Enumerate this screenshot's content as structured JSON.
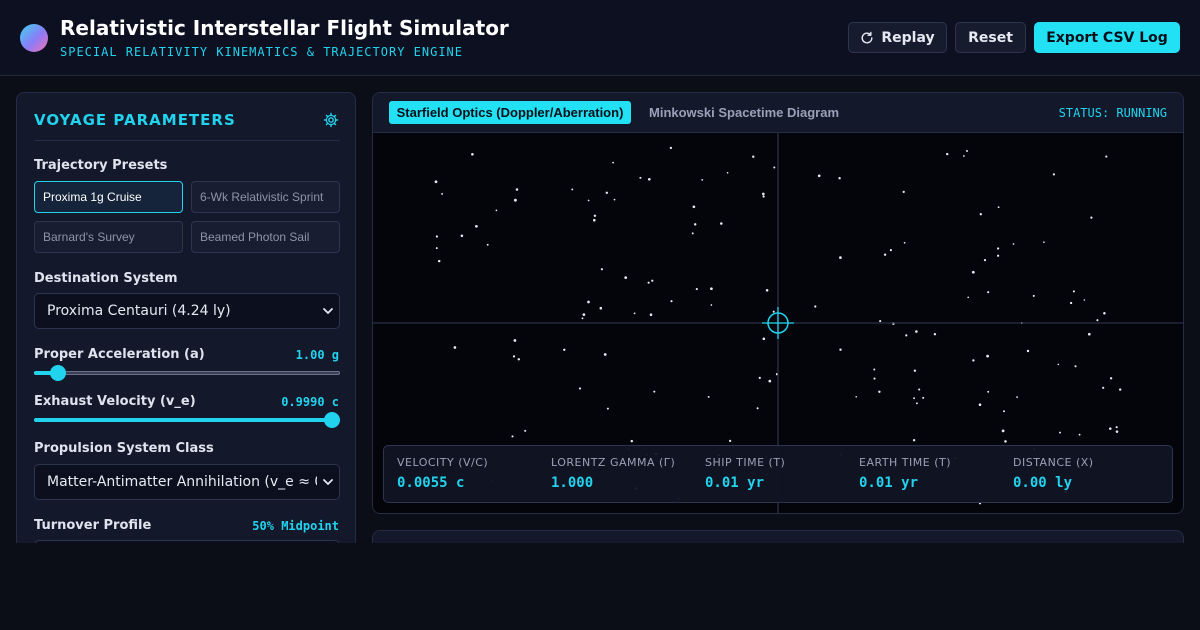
{
  "header": {
    "title": "Relativistic Interstellar Flight Simulator",
    "subtitle": "SPECIAL RELATIVITY KINEMATICS & TRAJECTORY ENGINE",
    "replay_label": "Replay",
    "reset_label": "Reset",
    "export_label": "Export CSV Log"
  },
  "sidebar": {
    "title": "VOYAGE PARAMETERS",
    "presets_label": "Trajectory Presets",
    "presets": [
      "Proxima 1g Cruise",
      "6-Wk Relativistic Sprint",
      "Barnard's Survey",
      "Beamed Photon Sail"
    ],
    "active_preset": "Proxima 1g Cruise",
    "destination_label": "Destination System",
    "destination_value": "Proxima Centauri (4.24 ly)",
    "acceleration_label": "Proper Acceleration (a)",
    "acceleration_value": "1.00 g",
    "acceleration_fraction": 0.08,
    "exhaust_label": "Exhaust Velocity (v_e)",
    "exhaust_value": "0.9990 c",
    "exhaust_fraction": 1.0,
    "propulsion_label": "Propulsion System Class",
    "propulsion_value": "Matter-Antimatter Annihilation (v_e ≈ 0",
    "turnover_label": "Turnover Profile",
    "turnover_value": "50% Midpoint"
  },
  "viz": {
    "tabs": [
      "Starfield Optics (Doppler/Aberration)",
      "Minkowski Spacetime Diagram"
    ],
    "active_tab": "Starfield Optics (Doppler/Aberration)",
    "status": "STATUS: RUNNING",
    "readouts": [
      {
        "label": "VELOCITY (V/C)",
        "value": "0.0055 c"
      },
      {
        "label": "LORENTZ GAMMA (Γ)",
        "value": "1.000"
      },
      {
        "label": "SHIP TIME (T)",
        "value": "0.01 yr"
      },
      {
        "label": "EARTH TIME (T)",
        "value": "0.01 yr"
      },
      {
        "label": "DISTANCE (X)",
        "value": "0.00 ly"
      }
    ]
  },
  "colors": {
    "accent": "#22d3ee",
    "background": "#0b0d17",
    "panel": "#14182b"
  },
  "icons": {
    "replay": "replay-icon",
    "gear": "gear-icon",
    "crosshair": "crosshair-icon",
    "chevron": "chevron-down-icon"
  }
}
